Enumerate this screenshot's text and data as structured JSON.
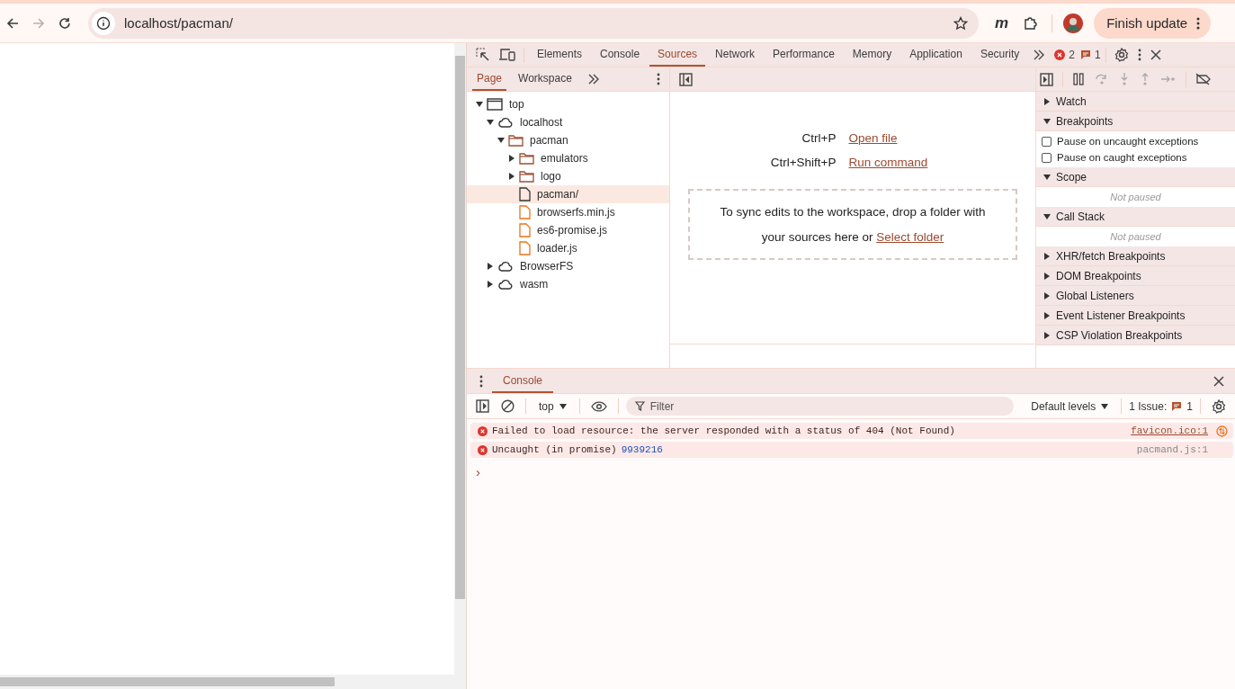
{
  "browser": {
    "url": "localhost/pacman/",
    "extension_label": "m",
    "update_button": "Finish update"
  },
  "devtools": {
    "tabs": [
      {
        "label": "Elements",
        "selected": false
      },
      {
        "label": "Console",
        "selected": false
      },
      {
        "label": "Sources",
        "selected": true
      },
      {
        "label": "Network",
        "selected": false
      },
      {
        "label": "Performance",
        "selected": false
      },
      {
        "label": "Memory",
        "selected": false
      },
      {
        "label": "Application",
        "selected": false
      },
      {
        "label": "Security",
        "selected": false
      }
    ],
    "error_count": "2",
    "warning_count": "1"
  },
  "navigator": {
    "subtabs": [
      {
        "label": "Page",
        "selected": true
      },
      {
        "label": "Workspace",
        "selected": false
      }
    ],
    "tree": [
      {
        "label": "top",
        "kind": "frame",
        "expanded": true,
        "selected": false,
        "children": [
          {
            "label": "localhost",
            "kind": "domain",
            "expanded": true,
            "selected": false,
            "children": [
              {
                "label": "pacman",
                "kind": "folder",
                "expanded": true,
                "selected": false,
                "children": [
                  {
                    "label": "emulators",
                    "kind": "folder",
                    "expanded": false,
                    "selected": false
                  },
                  {
                    "label": "logo",
                    "kind": "folder",
                    "expanded": false,
                    "selected": false
                  },
                  {
                    "label": "pacman/",
                    "kind": "document",
                    "selected": true
                  },
                  {
                    "label": "browserfs.min.js",
                    "kind": "script",
                    "selected": false
                  },
                  {
                    "label": "es6-promise.js",
                    "kind": "script",
                    "selected": false
                  },
                  {
                    "label": "loader.js",
                    "kind": "script",
                    "selected": false
                  }
                ]
              }
            ]
          },
          {
            "label": "BrowserFS",
            "kind": "domain",
            "expanded": false,
            "selected": false
          },
          {
            "label": "wasm",
            "kind": "domain",
            "expanded": false,
            "selected": false
          }
        ]
      }
    ]
  },
  "editor": {
    "shortcuts": [
      {
        "keys": "Ctrl+P",
        "action": "Open file"
      },
      {
        "keys": "Ctrl+Shift+P",
        "action": "Run command"
      }
    ],
    "drop_text": "To sync edits to the workspace, drop a folder with your sources here or",
    "drop_link": "Select folder"
  },
  "debugger": {
    "sections": [
      {
        "title": "Watch",
        "expanded": false,
        "kind": "plain"
      },
      {
        "title": "Breakpoints",
        "expanded": true,
        "kind": "checkboxes",
        "checkboxes": [
          {
            "label": "Pause on uncaught exceptions",
            "checked": false
          },
          {
            "label": "Pause on caught exceptions",
            "checked": false
          }
        ]
      },
      {
        "title": "Scope",
        "expanded": true,
        "kind": "message",
        "message": "Not paused"
      },
      {
        "title": "Call Stack",
        "expanded": true,
        "kind": "message",
        "message": "Not paused"
      },
      {
        "title": "XHR/fetch Breakpoints",
        "expanded": false,
        "kind": "plain"
      },
      {
        "title": "DOM Breakpoints",
        "expanded": false,
        "kind": "plain"
      },
      {
        "title": "Global Listeners",
        "expanded": false,
        "kind": "plain"
      },
      {
        "title": "Event Listener Breakpoints",
        "expanded": false,
        "kind": "plain"
      },
      {
        "title": "CSP Violation Breakpoints",
        "expanded": false,
        "kind": "plain"
      }
    ]
  },
  "console": {
    "tab": {
      "label": "Console",
      "selected": true
    },
    "context": "top",
    "filter": {
      "placeholder": "Filter"
    },
    "levels": "Default levels",
    "issues_label": "1 Issue:",
    "issues_count": "1",
    "messages": [
      {
        "kind": "error",
        "text": "Failed to load resource: the server responded with a status of 404 (Not Found)",
        "source": "favicon.ico:1",
        "linked": true
      },
      {
        "kind": "error",
        "text": "Uncaught (in promise)",
        "value": "9939216",
        "source": "pacmand.js:1",
        "linked": false
      }
    ],
    "prompt": "›"
  }
}
